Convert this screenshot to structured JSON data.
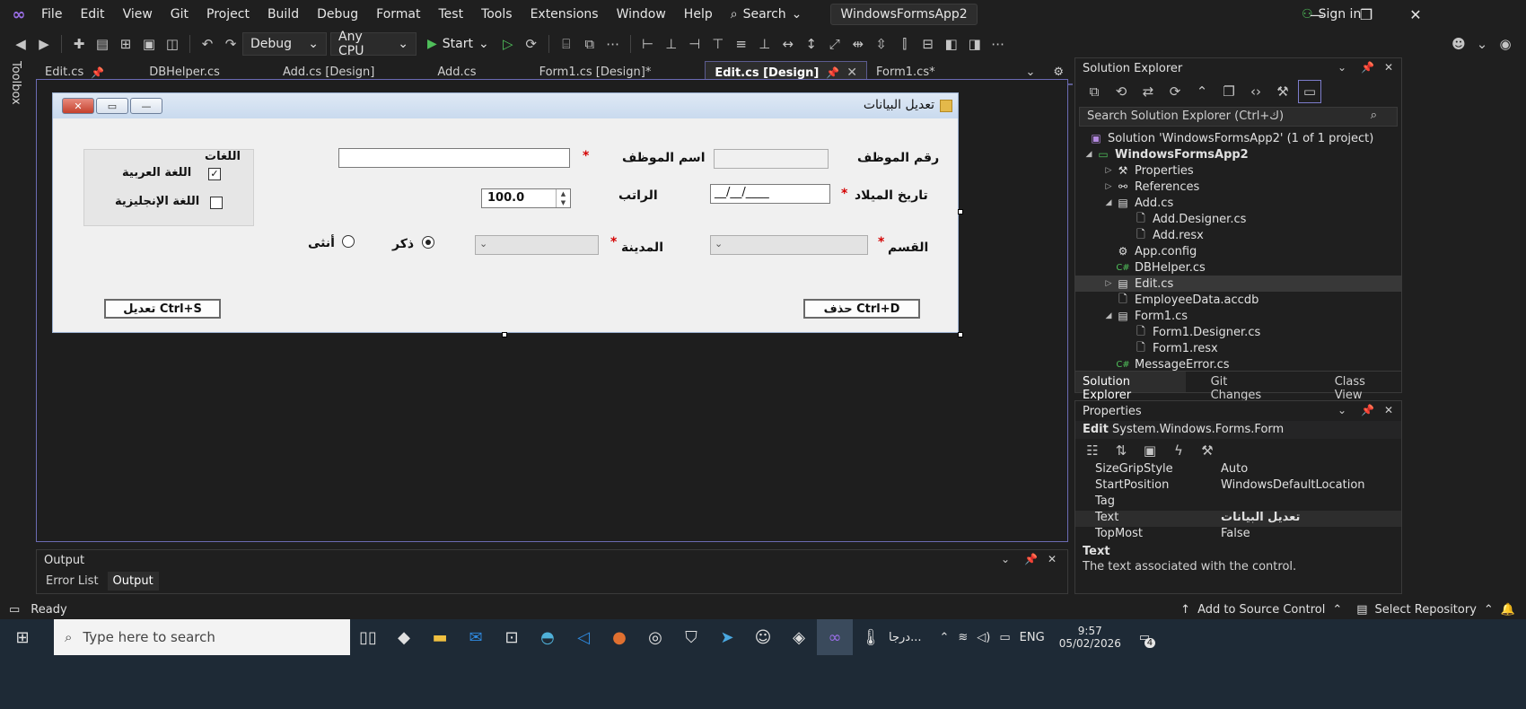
{
  "menu": {
    "items": [
      "File",
      "Edit",
      "View",
      "Git",
      "Project",
      "Build",
      "Debug",
      "Format",
      "Test",
      "Tools",
      "Extensions",
      "Window",
      "Help"
    ],
    "search_label": "Search",
    "solution_name": "WindowsFormsApp2",
    "signin": "Sign in"
  },
  "toolbar": {
    "config": "Debug",
    "platform": "Any CPU",
    "start": "Start"
  },
  "toolbox_label": "Toolbox",
  "doc_tabs": [
    {
      "label": "Edit.cs"
    },
    {
      "label": "DBHelper.cs"
    },
    {
      "label": "Add.cs [Design]"
    },
    {
      "label": "Add.cs"
    },
    {
      "label": "Form1.cs [Design]*"
    },
    {
      "label": "Edit.cs [Design]"
    },
    {
      "label": "Form1.cs*"
    }
  ],
  "form": {
    "title": "تعديل البيانات",
    "emp_no_label": "رقم الموظف",
    "emp_name_label": "اسم الموظف",
    "birth_label": "تاريخ الميلاد",
    "birth_mask": "__/__/____",
    "salary_label": "الراتب",
    "salary_value": "100.0",
    "dept_label": "القسم",
    "city_label": "المدينة",
    "male_label": "ذكر",
    "female_label": "أنثى",
    "langs_title": "اللغات",
    "lang_ar": "اللغة العربية",
    "lang_en": "اللغة الإنجليزية",
    "delete_btn": "حذف Ctrl+D",
    "edit_btn": "تعديل Ctrl+S",
    "required_mark": "*"
  },
  "solution_explorer": {
    "title": "Solution Explorer",
    "search_placeholder": "Search Solution Explorer (Ctrl+ك)",
    "tree": [
      {
        "label": "Solution 'WindowsFormsApp2' (1 of 1 project)"
      },
      {
        "label": "WindowsFormsApp2"
      },
      {
        "label": "Properties"
      },
      {
        "label": "References"
      },
      {
        "label": "Add.cs"
      },
      {
        "label": "Add.Designer.cs"
      },
      {
        "label": "Add.resx"
      },
      {
        "label": "App.config"
      },
      {
        "label": "DBHelper.cs"
      },
      {
        "label": "Edit.cs"
      },
      {
        "label": "EmployeeData.accdb"
      },
      {
        "label": "Form1.cs"
      },
      {
        "label": "Form1.Designer.cs"
      },
      {
        "label": "Form1.resx"
      },
      {
        "label": "MessageError.cs"
      }
    ],
    "tabs": [
      "Solution Explorer",
      "Git Changes",
      "Class View"
    ]
  },
  "properties": {
    "title": "Properties",
    "object_name": "Edit",
    "object_type": "System.Windows.Forms.Form",
    "rows": [
      {
        "key": "SizeGripStyle",
        "value": "Auto"
      },
      {
        "key": "StartPosition",
        "value": "WindowsDefaultLocation"
      },
      {
        "key": "Tag",
        "value": ""
      },
      {
        "key": "Text",
        "value": "تعديل البيانات"
      },
      {
        "key": "TopMost",
        "value": "False"
      }
    ],
    "desc_title": "Text",
    "desc_text": "The text associated with the control."
  },
  "output": {
    "title": "Output",
    "tabs": [
      "Error List",
      "Output"
    ]
  },
  "status": {
    "ready": "Ready",
    "source_control": "Add to Source Control",
    "repo": "Select Repository"
  },
  "taskbar": {
    "search_placeholder": "Type here to search",
    "weather_text": "درجا...",
    "lang": "ENG",
    "time": "9:57",
    "date": "05/02/2026",
    "notif_count": "4"
  }
}
